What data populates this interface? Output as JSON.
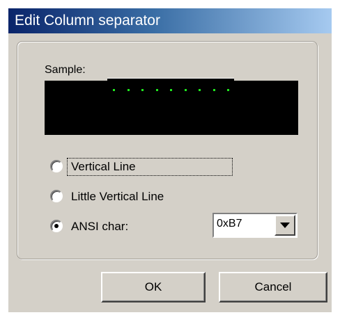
{
  "window": {
    "title": "Edit Column separator"
  },
  "sample": {
    "label": "Sample:",
    "preview_dot_color": "#1fe61f",
    "preview_dot_count": 9
  },
  "options": [
    {
      "label": "Vertical Line",
      "selected": false,
      "focused": true
    },
    {
      "label": "Little Vertical Line",
      "selected": false,
      "focused": false
    },
    {
      "label": "ANSI char:",
      "selected": true,
      "focused": false
    }
  ],
  "ansi_char": {
    "value": "0xB7"
  },
  "buttons": {
    "ok": "OK",
    "cancel": "Cancel"
  },
  "colors": {
    "title_gradient_start": "#0a246a",
    "title_gradient_end": "#a6caf0",
    "dialog_background": "#d4d0c8",
    "preview_background": "#000000"
  }
}
